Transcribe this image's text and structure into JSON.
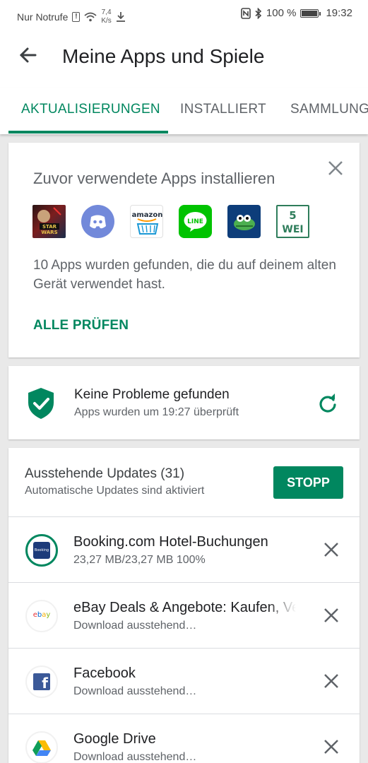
{
  "status_bar": {
    "carrier": "Nur Notrufe",
    "speed_value": "7,4",
    "speed_unit": "K/s",
    "battery": "100 %",
    "battery_level": 1.0,
    "time": "19:32"
  },
  "header": {
    "title": "Meine Apps und Spiele"
  },
  "tabs": [
    {
      "label": "AKTUALISIERUNGEN",
      "active": true
    },
    {
      "label": "INSTALLIERT",
      "active": false
    },
    {
      "label": "SAMMLUNG",
      "active": false
    }
  ],
  "restore_card": {
    "title": "Zuvor verwendete Apps installieren",
    "icons": [
      "star-wars-app-icon",
      "discord-app-icon",
      "amazon-app-icon",
      "line-app-icon",
      "crocodile-game-app-icon",
      "five-words-app-icon"
    ],
    "amazon_label": "amazon",
    "line_label": "LINE",
    "five_words_number": "5",
    "five_words_label": "WEI",
    "description": "10 Apps wurden gefunden, die du auf deinem alten Gerät verwendet hast.",
    "action": "ALLE PRÜFEN"
  },
  "protect_card": {
    "title": "Keine Probleme gefunden",
    "subtitle": "Apps wurden um 19:27 überprüft",
    "accent_color": "#01875f"
  },
  "updates_card": {
    "title": "Ausstehende Updates (31)",
    "subtitle": "Automatische Updates sind aktiviert",
    "stop_label": "STOPP",
    "items": [
      {
        "name": "Booking.com Hotel-Buchungen",
        "status": "23,27 MB/23,27 MB   100%",
        "progress": 1.0,
        "icon": "booking-app-icon",
        "icon_text": "Booking"
      },
      {
        "name": "eBay Deals & Angebote: Kaufen, Verkaufen",
        "status": "Download ausstehend…",
        "icon": "ebay-app-icon",
        "icon_text": "ebay"
      },
      {
        "name": "Facebook",
        "status": "Download ausstehend…",
        "icon": "facebook-app-icon",
        "icon_text": "f"
      },
      {
        "name": "Google Drive",
        "status": "Download ausstehend…",
        "icon": "google-drive-app-icon"
      }
    ]
  }
}
